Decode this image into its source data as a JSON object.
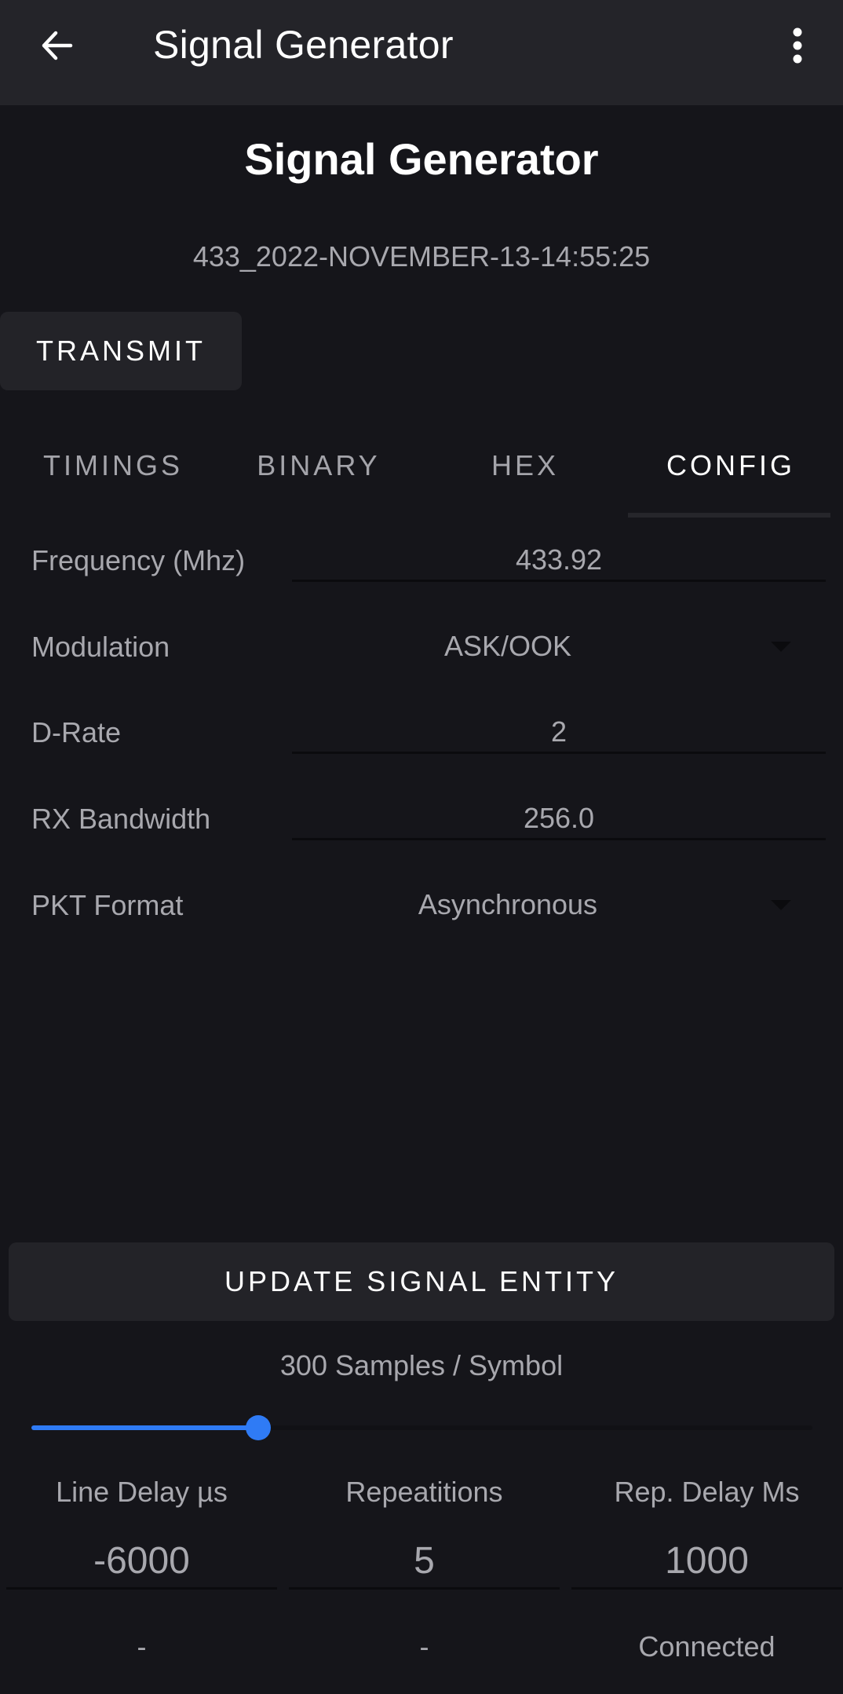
{
  "appbar": {
    "title": "Signal Generator",
    "back_icon": "arrow-back-icon",
    "menu_icon": "more-vert-icon"
  },
  "header": {
    "title": "Signal Generator",
    "signal_name": "433_2022-NOVEMBER-13-14:55:25"
  },
  "actions": {
    "transmit_label": "TRANSMIT",
    "update_label": "UPDATE SIGNAL ENTITY"
  },
  "tabs": [
    {
      "label": "TIMINGS",
      "active": false
    },
    {
      "label": "BINARY",
      "active": false
    },
    {
      "label": "HEX",
      "active": false
    },
    {
      "label": "CONFIG",
      "active": true
    }
  ],
  "config": {
    "frequency": {
      "label": "Frequency (Mhz)",
      "value": "433.92"
    },
    "modulation": {
      "label": "Modulation",
      "value": "ASK/OOK"
    },
    "drate": {
      "label": "D-Rate",
      "value": "2"
    },
    "rx_bandwidth": {
      "label": "RX Bandwidth",
      "value": "256.0"
    },
    "pkt_format": {
      "label": "PKT Format",
      "value": "Asynchronous"
    }
  },
  "samples": {
    "label": "300 Samples / Symbol",
    "slider_fraction": 0.29
  },
  "params": [
    {
      "label": "Line Delay µs",
      "value": "-6000",
      "status": "-"
    },
    {
      "label": "Repeatitions",
      "value": "5",
      "status": "-"
    },
    {
      "label": "Rep. Delay Ms",
      "value": "1000",
      "status": "Connected"
    }
  ],
  "colors": {
    "accent": "#2f7bf5",
    "background": "#15151a",
    "appbar": "#242429",
    "button": "#232328"
  }
}
